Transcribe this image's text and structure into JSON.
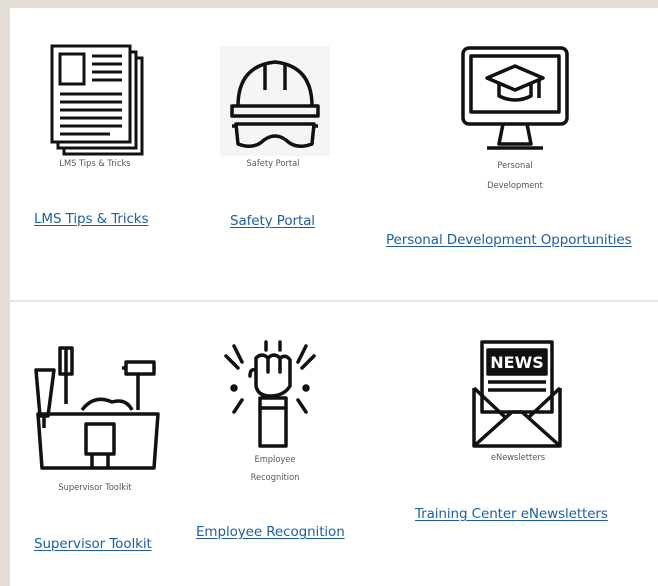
{
  "tiles": [
    {
      "caption": "LMS Tips & Tricks",
      "link": "LMS Tips & Tricks",
      "icon": "newspaper-stack-icon"
    },
    {
      "caption": "Safety Portal",
      "link": "Safety Portal",
      "icon": "hard-hat-goggles-icon"
    },
    {
      "caption_lines": [
        "Personal",
        "Development"
      ],
      "link": "Personal Development Opportunities",
      "icon": "monitor-graduation-cap-icon"
    },
    {
      "caption": "Supervisor Toolkit",
      "link": "Supervisor Toolkit",
      "icon": "toolbox-icon"
    },
    {
      "caption_lines": [
        "Employee",
        "Recognition"
      ],
      "link": "Employee Recognition",
      "icon": "raised-fist-icon"
    },
    {
      "caption": "eNewsletters",
      "link": "Training Center eNewsletters",
      "icon": "news-envelope-icon",
      "icon_text": "NEWS"
    }
  ],
  "colors": {
    "page_bg": "#e3ded5",
    "panel_bg": "#ffffff",
    "link": "#1d5fa6",
    "caption": "#555555"
  }
}
